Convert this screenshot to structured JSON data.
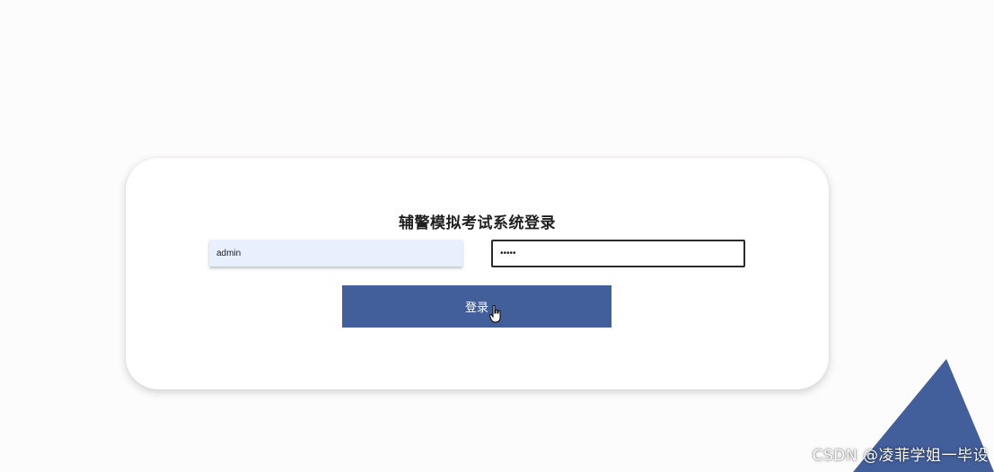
{
  "login": {
    "title": "辅警模拟考试系统登录",
    "username_value": "admin",
    "password_value": "•••••",
    "submit_label": "登录"
  },
  "decoration": {
    "triangle_color": "#425e9b"
  },
  "watermark": {
    "text": "CSDN @凌菲学姐一毕设"
  },
  "colors": {
    "button": "#425e9b",
    "username_bg": "#e8f0fe",
    "card_bg": "#ffffff",
    "page_bg": "#fdfcfc"
  }
}
